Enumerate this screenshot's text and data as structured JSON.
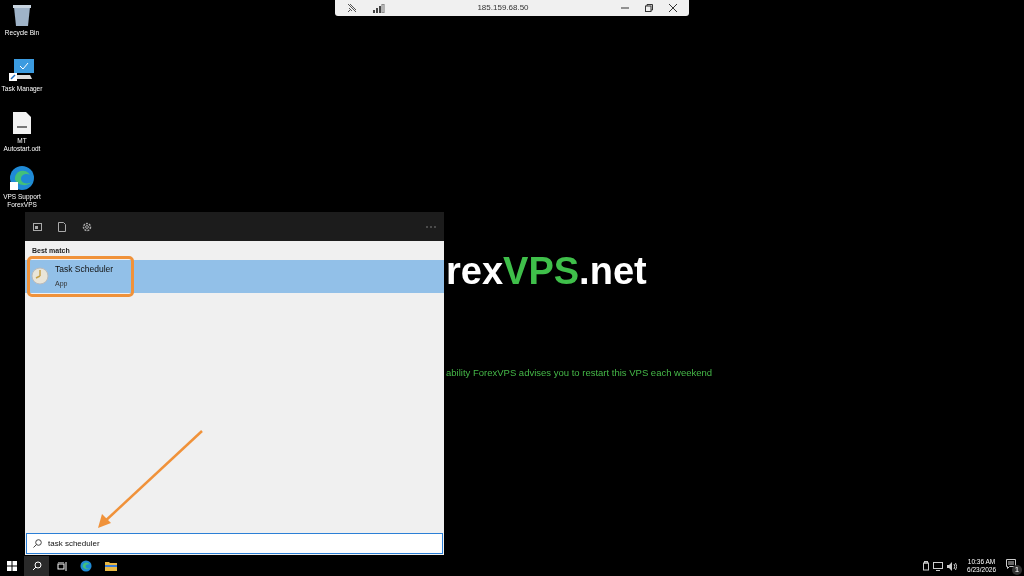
{
  "desktop_icons": [
    {
      "label": "Recycle Bin",
      "kind": "bin"
    },
    {
      "label": "Task Manager",
      "kind": "monitor"
    },
    {
      "label": "MT Autostart.odt",
      "kind": "document"
    },
    {
      "label": "VPS Support ForexVPS",
      "kind": "edge"
    }
  ],
  "remote_bar": {
    "title": "185.159.68.50"
  },
  "wallpaper": {
    "logo_dark": "rex",
    "logo_green": "VPS",
    "logo_suffix": ".net",
    "notice": "ability ForexVPS advises you to restart this VPS each weekend"
  },
  "start_search": {
    "section": "Best match",
    "results": [
      {
        "title": "Task Scheduler",
        "subtitle": "App",
        "selected": true
      }
    ],
    "value": "task scheduler"
  },
  "tray": {
    "time": "10:36 AM",
    "date": "6/23/2026",
    "notifications": "1"
  }
}
